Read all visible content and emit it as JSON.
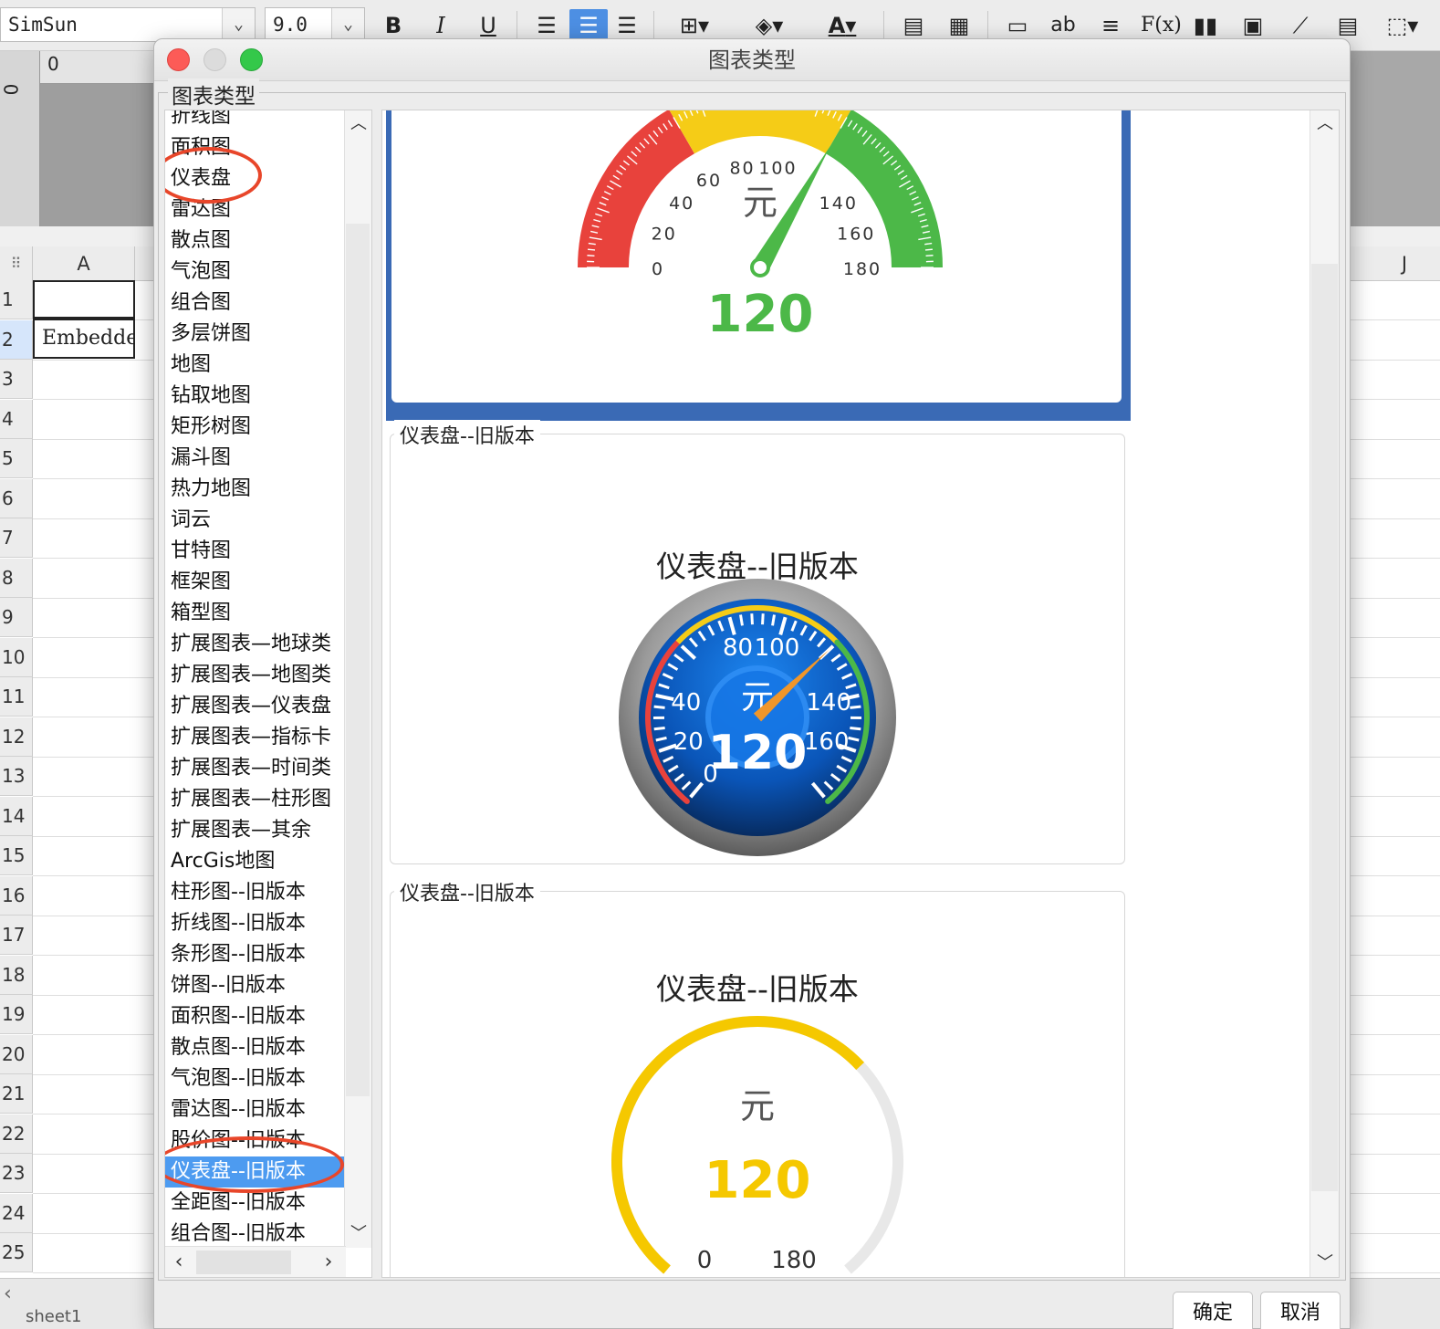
{
  "toolbar": {
    "font_name": "SimSun",
    "font_size": "9.0",
    "bold": "B",
    "italic": "I",
    "underline": "U",
    "fx": "F(x)",
    "ab": "ab",
    "font_color": "A"
  },
  "ruler": {
    "h_zero": "0",
    "v_zero": "0"
  },
  "sheet": {
    "columns": [
      "A",
      "J"
    ],
    "rows": [
      "1",
      "2",
      "3",
      "4",
      "5",
      "6",
      "7",
      "8",
      "9",
      "10",
      "11",
      "12",
      "13",
      "14",
      "15",
      "16",
      "17",
      "18",
      "19",
      "20",
      "21",
      "22",
      "23",
      "24",
      "25"
    ],
    "cell_a2": "Embedde",
    "tab_name": "sheet1"
  },
  "dialog": {
    "title": "图表类型",
    "group_label": "图表类型",
    "ok": "确定",
    "cancel": "取消",
    "list": {
      "items": [
        "折线图",
        "面积图",
        "仪表盘",
        "雷达图",
        "散点图",
        "气泡图",
        "组合图",
        "多层饼图",
        "地图",
        "钻取地图",
        "矩形树图",
        "漏斗图",
        "热力地图",
        "词云",
        "甘特图",
        "框架图",
        "箱型图",
        "扩展图表—地球类",
        "扩展图表—地图类",
        "扩展图表—仪表盘",
        "扩展图表—指标卡",
        "扩展图表—时间类",
        "扩展图表—柱形图",
        "扩展图表—其余",
        "ArcGis地图",
        "柱形图--旧版本",
        "折线图--旧版本",
        "条形图--旧版本",
        "饼图--旧版本",
        "面积图--旧版本",
        "散点图--旧版本",
        "气泡图--旧版本",
        "雷达图--旧版本",
        "股价图--旧版本",
        "仪表盘--旧版本",
        "全距图--旧版本",
        "组合图--旧版本"
      ],
      "selected": "仪表盘--旧版本",
      "circled": [
        "仪表盘",
        "仪表盘--旧版本"
      ]
    }
  },
  "gauges": [
    {
      "card_label": "",
      "title": "",
      "unit": "元",
      "value": "120",
      "min": 0,
      "max": 180,
      "ticks": [
        "0",
        "20",
        "40",
        "60",
        "80",
        "100",
        "140",
        "160",
        "180"
      ],
      "bands": [
        {
          "to": 60,
          "color": "#e8423c"
        },
        {
          "to": 120,
          "color": "#f5cc17"
        },
        {
          "to": 180,
          "color": "#4cb848"
        }
      ],
      "value_color": "#4cb848"
    },
    {
      "card_label": "仪表盘--旧版本",
      "title": "仪表盘--旧版本",
      "unit": "元",
      "value": "120",
      "min": 0,
      "max": 180,
      "ticks": [
        "0",
        "20",
        "40",
        "80",
        "100",
        "140",
        "160"
      ],
      "face_color": "#0a55b8",
      "needle_color": "#f0962a"
    },
    {
      "card_label": "仪表盘--旧版本",
      "title": "仪表盘--旧版本",
      "unit": "元",
      "value": "120",
      "min": "0",
      "max": "180",
      "value_color": "#f5c800"
    }
  ],
  "colors": {
    "accent": "#4d8fe3",
    "selection": "#4d9bf0",
    "highlight_ring": "#e8462a",
    "preview_frame": "#3a6ab5"
  }
}
